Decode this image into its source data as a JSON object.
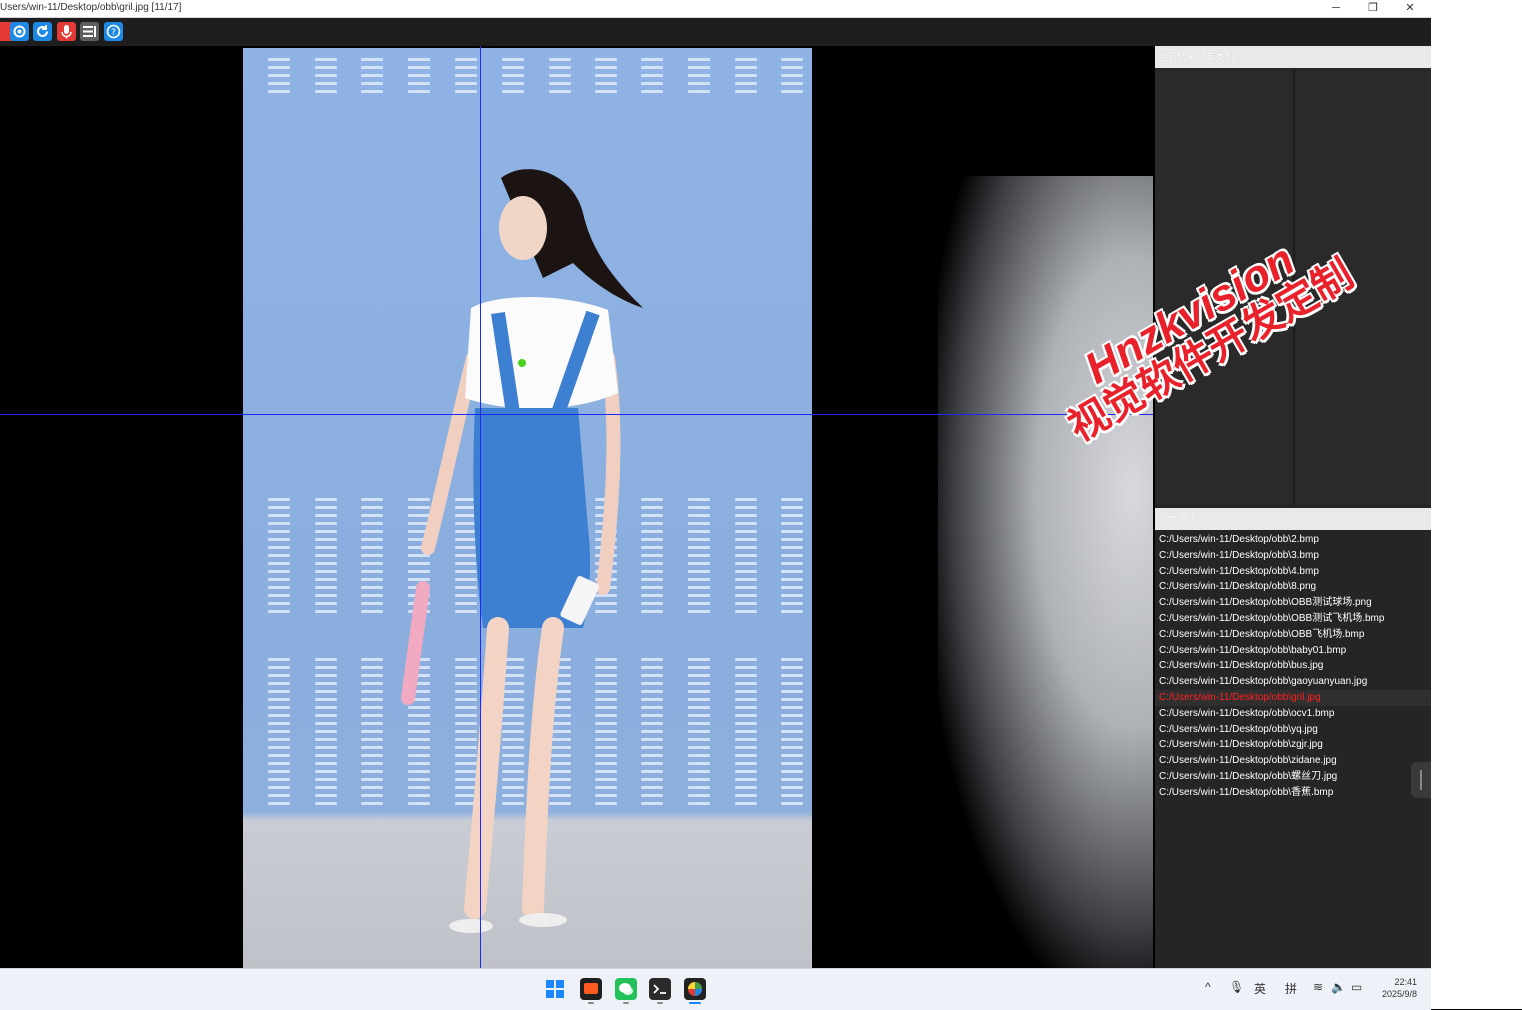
{
  "window": {
    "title": "Users/win-11/Desktop/obb\\gril.jpg [11/17]",
    "min_glyph": "─",
    "max_glyph": "❐",
    "close_glyph": "✕"
  },
  "toolbar": {
    "buttons": [
      {
        "name": "open-icon",
        "color": "#e53935"
      },
      {
        "name": "settings-icon",
        "color": "#1e88e5"
      },
      {
        "name": "refresh-icon",
        "color": "#1e88e5"
      },
      {
        "name": "record-icon",
        "color": "#e53935"
      },
      {
        "name": "list-icon",
        "color": "#616161"
      },
      {
        "name": "help-icon",
        "color": "#1e88e5"
      }
    ]
  },
  "panel": {
    "result_header": "当前结果[所有类别]",
    "files_header": "图像地址",
    "files": [
      "C:/Users/win-11/Desktop/obb\\2.bmp",
      "C:/Users/win-11/Desktop/obb\\3.bmp",
      "C:/Users/win-11/Desktop/obb\\4.bmp",
      "C:/Users/win-11/Desktop/obb\\8.png",
      "C:/Users/win-11/Desktop/obb\\OBB测试球场.png",
      "C:/Users/win-11/Desktop/obb\\OBB测试飞机场.bmp",
      "C:/Users/win-11/Desktop/obb\\OBB飞机场.bmp",
      "C:/Users/win-11/Desktop/obb\\baby01.bmp",
      "C:/Users/win-11/Desktop/obb\\bus.jpg",
      "C:/Users/win-11/Desktop/obb\\gaoyuanyuan.jpg",
      "C:/Users/win-11/Desktop/obb\\gril.jpg",
      "C:/Users/win-11/Desktop/obb\\ocv1.bmp",
      "C:/Users/win-11/Desktop/obb\\yq.jpg",
      "C:/Users/win-11/Desktop/obb\\zgjr.jpg",
      "C:/Users/win-11/Desktop/obb\\zidane.jpg",
      "C:/Users/win-11/Desktop/obb\\螺丝刀.jpg",
      "C:/Users/win-11/Desktop/obb\\香蕉.bmp"
    ],
    "active_index": 10
  },
  "watermark": {
    "line1": "Hnzkvision",
    "line2": "视觉软件开发定制"
  },
  "taskbar": {
    "apps": [
      "windows-start-icon",
      "app-orange-icon",
      "wechat-icon",
      "terminal-icon",
      "vision-app-icon"
    ],
    "tray": {
      "chevron": "^",
      "mic": "🎙",
      "lang1": "英",
      "lang2": "拼",
      "wifi": "≋",
      "volume": "🔈",
      "battery": "▭"
    },
    "time": "22:41",
    "date": "2025/9/8"
  },
  "colors": {
    "active_file": "#ff2020",
    "crosshair": "#1b2bff",
    "watermark": "#e8212a"
  }
}
